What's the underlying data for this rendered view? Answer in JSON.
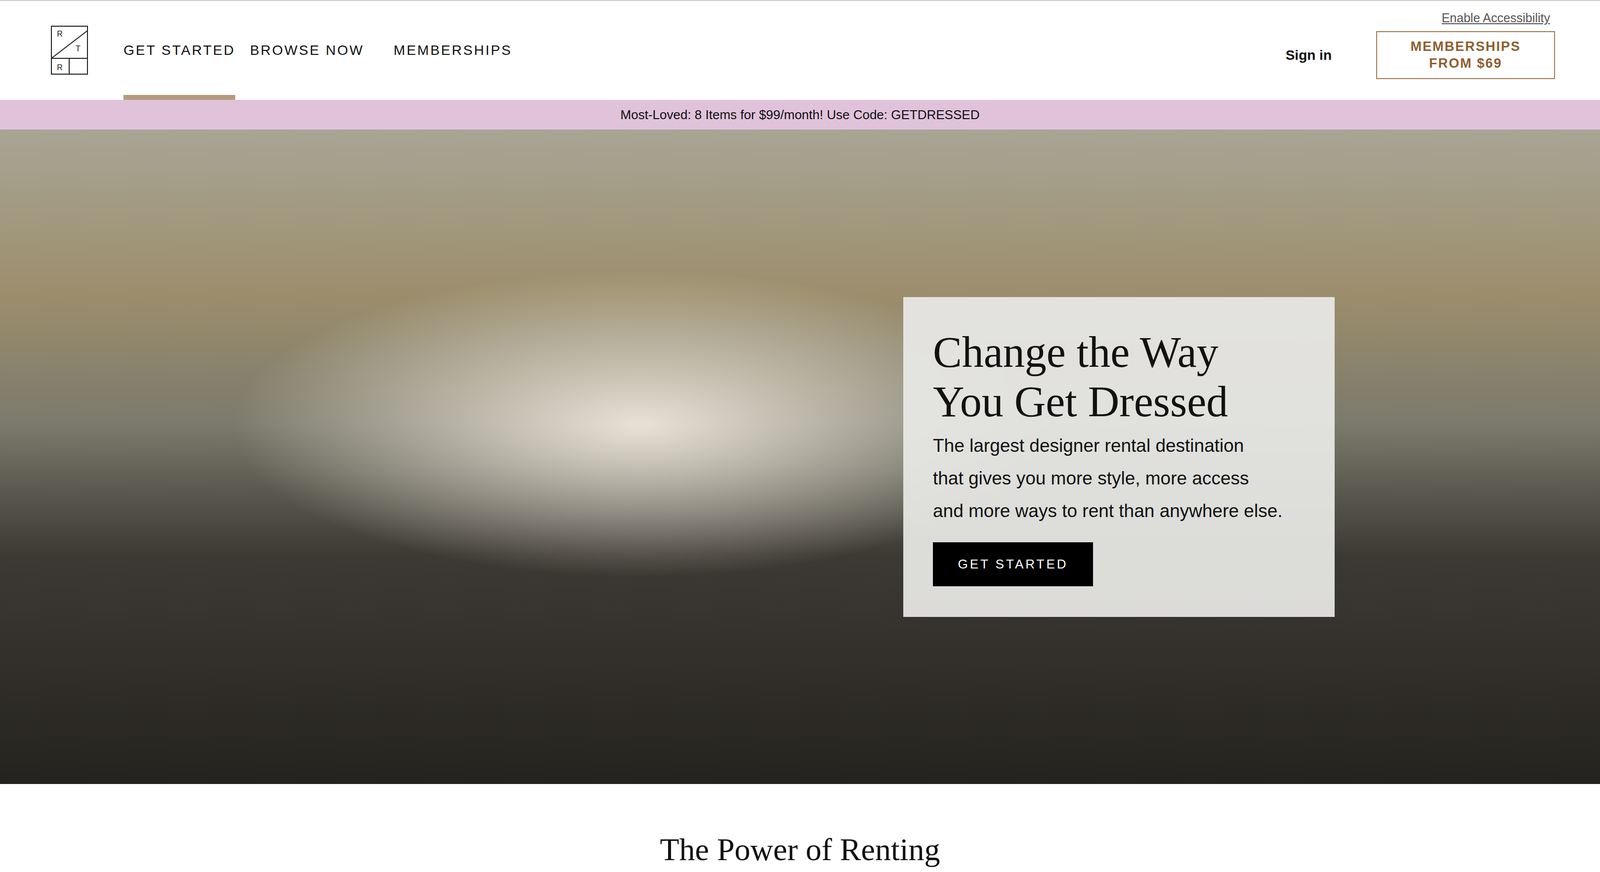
{
  "header": {
    "logo": {
      "letters": [
        "R",
        "T",
        "R"
      ]
    },
    "nav": [
      {
        "label": "GET STARTED",
        "selected": true
      },
      {
        "label": "BROWSE NOW",
        "selected": false
      },
      {
        "label": "MEMBERSHIPS",
        "selected": false
      }
    ],
    "accessibility_link": "Enable Accessibility",
    "sign_in": "Sign in",
    "cta": {
      "lines": [
        "MEMBERSHIPS",
        "FROM $69"
      ]
    }
  },
  "promo_bar": {
    "text": "Most-Loved: 8 Items for $99/month! Use Code: GETDRESSED"
  },
  "hero": {
    "heading": [
      "Change the Way",
      "You Get Dressed"
    ],
    "body": [
      "The largest designer rental destination",
      "that gives you more style, more access",
      "and more ways to rent than anywhere else."
    ],
    "button": "GET STARTED"
  },
  "section": {
    "heading": "The Power of Renting"
  }
}
